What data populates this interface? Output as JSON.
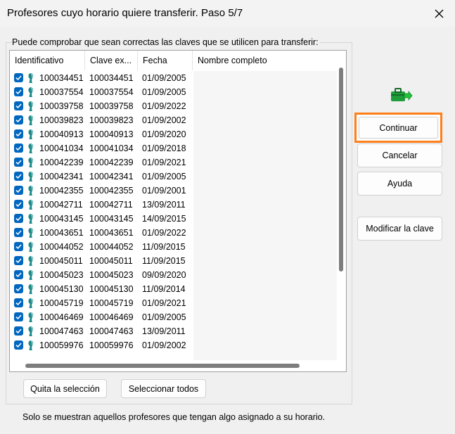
{
  "window": {
    "title": "Profesores cuyo horario quiere transferir. Paso 5/7"
  },
  "group": {
    "label": "Puede comprobar que sean correctas las claves que se utilicen para transferir:"
  },
  "table": {
    "columns": [
      "Identificativo",
      "Clave ex...",
      "Fecha",
      "Nombre completo"
    ],
    "rows": [
      {
        "id": "100034451",
        "clave": "100034451",
        "fecha": "01/09/2005",
        "checked": true
      },
      {
        "id": "100037554",
        "clave": "100037554",
        "fecha": "01/09/2005",
        "checked": true
      },
      {
        "id": "100039758",
        "clave": "100039758",
        "fecha": "01/09/2022",
        "checked": true
      },
      {
        "id": "100039823",
        "clave": "100039823",
        "fecha": "01/09/2002",
        "checked": true
      },
      {
        "id": "100040913",
        "clave": "100040913",
        "fecha": "01/09/2020",
        "checked": true
      },
      {
        "id": "100041034",
        "clave": "100041034",
        "fecha": "01/09/2018",
        "checked": true
      },
      {
        "id": "100042239",
        "clave": "100042239",
        "fecha": "01/09/2021",
        "checked": true
      },
      {
        "id": "100042341",
        "clave": "100042341",
        "fecha": "01/09/2005",
        "checked": true
      },
      {
        "id": "100042355",
        "clave": "100042355",
        "fecha": "01/09/2001",
        "checked": true
      },
      {
        "id": "100042711",
        "clave": "100042711",
        "fecha": "13/09/2011",
        "checked": true
      },
      {
        "id": "100043145",
        "clave": "100043145",
        "fecha": "14/09/2015",
        "checked": true
      },
      {
        "id": "100043651",
        "clave": "100043651",
        "fecha": "01/09/2022",
        "checked": true
      },
      {
        "id": "100044052",
        "clave": "100044052",
        "fecha": "11/09/2015",
        "checked": true
      },
      {
        "id": "100045011",
        "clave": "100045011",
        "fecha": "11/09/2015",
        "checked": true
      },
      {
        "id": "100045023",
        "clave": "100045023",
        "fecha": "09/09/2020",
        "checked": true
      },
      {
        "id": "100045130",
        "clave": "100045130",
        "fecha": "11/09/2014",
        "checked": true
      },
      {
        "id": "100045719",
        "clave": "100045719",
        "fecha": "01/09/2021",
        "checked": true
      },
      {
        "id": "100046469",
        "clave": "100046469",
        "fecha": "01/09/2005",
        "checked": true
      },
      {
        "id": "100047463",
        "clave": "100047463",
        "fecha": "13/09/2011",
        "checked": true
      },
      {
        "id": "100059976",
        "clave": "100059976",
        "fecha": "01/09/2002",
        "checked": true
      }
    ]
  },
  "buttons": {
    "continue": "Continuar",
    "cancel": "Cancelar",
    "help": "Ayuda",
    "modify": "Modificar la clave",
    "clear_selection": "Quita la selección",
    "select_all": "Seleccionar todos"
  },
  "footer": {
    "note": "Solo se muestran aquellos profesores que tengan algo asignado a su horario."
  },
  "colors": {
    "accent": "#0067c0",
    "highlight_border": "#ff7f1a"
  },
  "icons": {
    "transfer": "transfer-icon",
    "close": "close-icon",
    "checkbox": "checkbox-checked-icon",
    "person": "person-icon"
  }
}
